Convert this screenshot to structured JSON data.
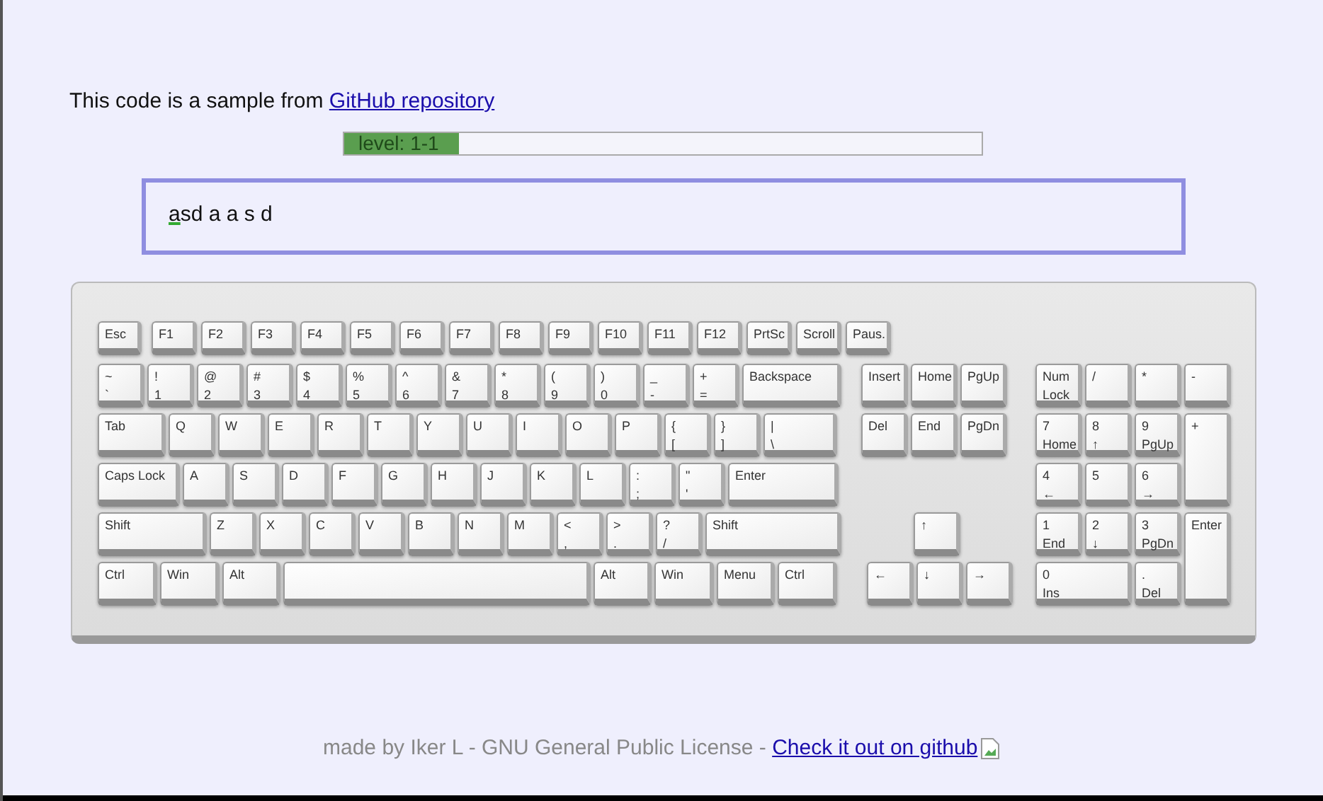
{
  "intro": {
    "text": "This code is a sample from ",
    "link": "GitHub repository"
  },
  "progress": {
    "label": "level: 1-1",
    "level": 0.18
  },
  "typing": {
    "current": "a",
    "rest": "sd a a s d"
  },
  "keyboard": {
    "main": [
      [
        [
          "Esc"
        ],
        [
          "F1"
        ],
        [
          "F2"
        ],
        [
          "F3"
        ],
        [
          "F4"
        ],
        [
          "F5"
        ],
        [
          "F6"
        ],
        [
          "F7"
        ],
        [
          "F8"
        ],
        [
          "F9"
        ],
        [
          "F10"
        ],
        [
          "F11"
        ],
        [
          "F12"
        ],
        [
          "PrtSc"
        ],
        [
          "Scroll"
        ],
        [
          "Paus."
        ]
      ],
      [
        [
          "~",
          "`"
        ],
        [
          "!",
          "1"
        ],
        [
          "@",
          "2"
        ],
        [
          "#",
          "3"
        ],
        [
          "$",
          "4"
        ],
        [
          "%",
          "5"
        ],
        [
          "^",
          "6"
        ],
        [
          "&",
          "7"
        ],
        [
          "*",
          "8"
        ],
        [
          "(",
          "9"
        ],
        [
          ")",
          "0"
        ],
        [
          "_",
          "-"
        ],
        [
          "+",
          "="
        ],
        [
          "Backspace"
        ]
      ],
      [
        [
          "Tab"
        ],
        [
          "Q"
        ],
        [
          "W"
        ],
        [
          "E"
        ],
        [
          "R"
        ],
        [
          "T"
        ],
        [
          "Y"
        ],
        [
          "U"
        ],
        [
          "I"
        ],
        [
          "O"
        ],
        [
          "P"
        ],
        [
          "{",
          "["
        ],
        [
          "}",
          "]"
        ],
        [
          "|",
          "\\"
        ]
      ],
      [
        [
          "Caps Lock"
        ],
        [
          "A"
        ],
        [
          "S"
        ],
        [
          "D"
        ],
        [
          "F"
        ],
        [
          "G"
        ],
        [
          "H"
        ],
        [
          "J"
        ],
        [
          "K"
        ],
        [
          "L"
        ],
        [
          ":",
          ";"
        ],
        [
          "\"",
          "'"
        ],
        [
          "Enter"
        ]
      ],
      [
        [
          "Shift"
        ],
        [
          "Z"
        ],
        [
          "X"
        ],
        [
          "C"
        ],
        [
          "V"
        ],
        [
          "B"
        ],
        [
          "N"
        ],
        [
          "M"
        ],
        [
          "<",
          ","
        ],
        [
          ">",
          "."
        ],
        [
          "?",
          "/"
        ],
        [
          "Shift"
        ]
      ],
      [
        [
          "Ctrl"
        ],
        [
          "Win"
        ],
        [
          "Alt"
        ],
        [
          "Alt"
        ],
        [
          "Win"
        ],
        [
          "Menu"
        ],
        [
          "Ctrl"
        ]
      ]
    ],
    "nav": [
      [
        [
          "Insert"
        ],
        [
          "Home"
        ],
        [
          "PgUp"
        ]
      ],
      [
        [
          "Del"
        ],
        [
          "End"
        ],
        [
          "PgDn"
        ]
      ]
    ],
    "arrows": [
      [
        "↑"
      ],
      [
        "←"
      ],
      [
        "↓"
      ],
      [
        "→"
      ]
    ],
    "numpad": [
      [
        "Num",
        "Lock"
      ],
      [
        "/"
      ],
      [
        "*"
      ],
      [
        "-"
      ],
      [
        "7",
        "Home"
      ],
      [
        "8",
        "↑"
      ],
      [
        "9",
        "PgUp"
      ],
      [
        "+"
      ],
      [
        "4",
        "←"
      ],
      [
        "5"
      ],
      [
        "6",
        "→"
      ],
      [
        "1",
        "End"
      ],
      [
        "2",
        "↓"
      ],
      [
        "3",
        "PgDn"
      ],
      [
        "Enter"
      ],
      [
        "0",
        "Ins"
      ],
      [
        ".",
        "Del"
      ]
    ]
  },
  "footer": {
    "text": "made by Iker L - GNU General Public License - ",
    "link": "Check it out on github"
  }
}
